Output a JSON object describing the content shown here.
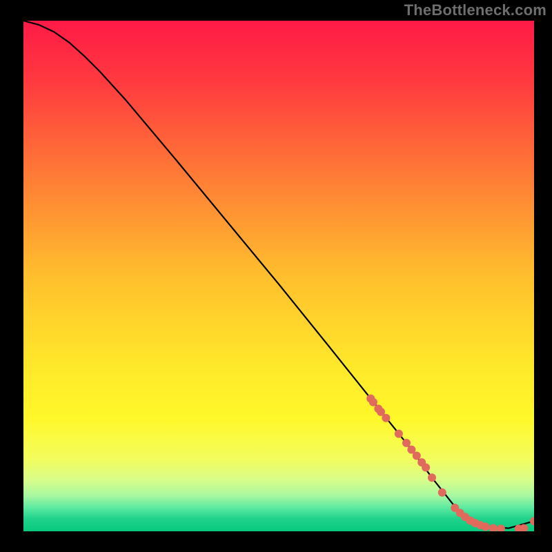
{
  "watermark": "TheBottleneck.com",
  "chart_data": {
    "type": "line",
    "title": "",
    "xlabel": "",
    "ylabel": "",
    "xlim": [
      0,
      100
    ],
    "ylim": [
      0,
      100
    ],
    "background_gradient": {
      "stops": [
        {
          "pos": 0.0,
          "color": "#ff1a46"
        },
        {
          "pos": 0.12,
          "color": "#ff3a3f"
        },
        {
          "pos": 0.3,
          "color": "#ff7a36"
        },
        {
          "pos": 0.5,
          "color": "#ffbf2d"
        },
        {
          "pos": 0.68,
          "color": "#ffe92a"
        },
        {
          "pos": 0.78,
          "color": "#fff82a"
        },
        {
          "pos": 0.86,
          "color": "#f2fd5f"
        },
        {
          "pos": 0.9,
          "color": "#d7fd8a"
        },
        {
          "pos": 0.93,
          "color": "#a8f8a0"
        },
        {
          "pos": 0.955,
          "color": "#59e9a0"
        },
        {
          "pos": 0.975,
          "color": "#21d28b"
        },
        {
          "pos": 1.0,
          "color": "#07c97e"
        }
      ]
    },
    "curve": {
      "stroke": "#000000",
      "stroke_width": 2.2,
      "x": [
        0,
        3,
        6,
        9,
        12,
        15,
        20,
        30,
        40,
        50,
        60,
        68,
        72,
        76,
        80,
        85,
        90,
        95,
        100
      ],
      "y": [
        100,
        99.2,
        97.8,
        95.7,
        93.0,
        90.0,
        84.5,
        72.6,
        60.5,
        48.4,
        36.0,
        26.0,
        21.0,
        16.0,
        10.5,
        4.2,
        1.0,
        0.6,
        2.0
      ]
    },
    "series": [
      {
        "name": "dots",
        "marker_color": "#e06a5c",
        "marker_radius": 6,
        "x": [
          68.0,
          68.5,
          69.5,
          70.0,
          71.0,
          73.5,
          75.0,
          76.0,
          77.0,
          78.0,
          78.8,
          80.0,
          82.0,
          84.5,
          85.5,
          86.5,
          87.5,
          88.5,
          89.5,
          90.5,
          92.0,
          93.5,
          97.0,
          98.0,
          100.0
        ],
        "y": [
          26.0,
          25.3,
          24.0,
          23.4,
          22.2,
          19.1,
          17.3,
          16.0,
          14.8,
          13.5,
          12.5,
          10.5,
          7.6,
          4.6,
          3.6,
          2.8,
          2.1,
          1.6,
          1.2,
          0.9,
          0.6,
          0.5,
          0.5,
          0.6,
          2.0
        ]
      }
    ]
  }
}
